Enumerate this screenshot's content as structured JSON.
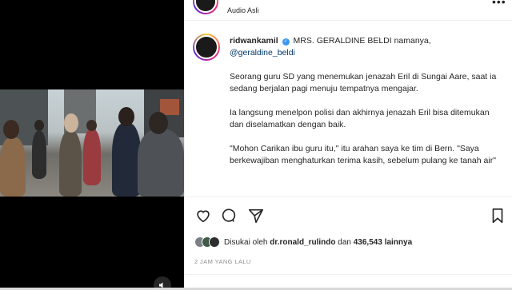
{
  "header": {
    "audio_label": "Audio Asli"
  },
  "caption": {
    "username": "ridwankamil",
    "line1": "MRS. GERALDINE BELDI namanya,",
    "mention": "@geraldine_beldi",
    "para1": "Seorang guru SD yang menemukan jenazah Eril di Sungai Aare, saat ia sedang berjalan pagi menuju tempatnya mengajar.",
    "para2": "Ia langsung menelpon polisi dan akhirnya jenazah Eril bisa ditemukan dan diselamatkan dengan baik.",
    "para3": "\"Mohon Carikan ibu guru itu,\" itu arahan saya ke tim di Bern. \"Saya berkewajiban menghaturkan terima kasih, sebelum pulang ke tanah air\""
  },
  "likes": {
    "prefix": "Disukai oleh",
    "user": "dr.ronald_rulindo",
    "middle": "dan",
    "count": "436,543",
    "suffix": "lainnya"
  },
  "timestamp": "2 JAM YANG LALU",
  "colors": {
    "verified": "#3897f0",
    "mention": "#00376b",
    "text": "#262626",
    "muted": "#8e8e8e"
  }
}
